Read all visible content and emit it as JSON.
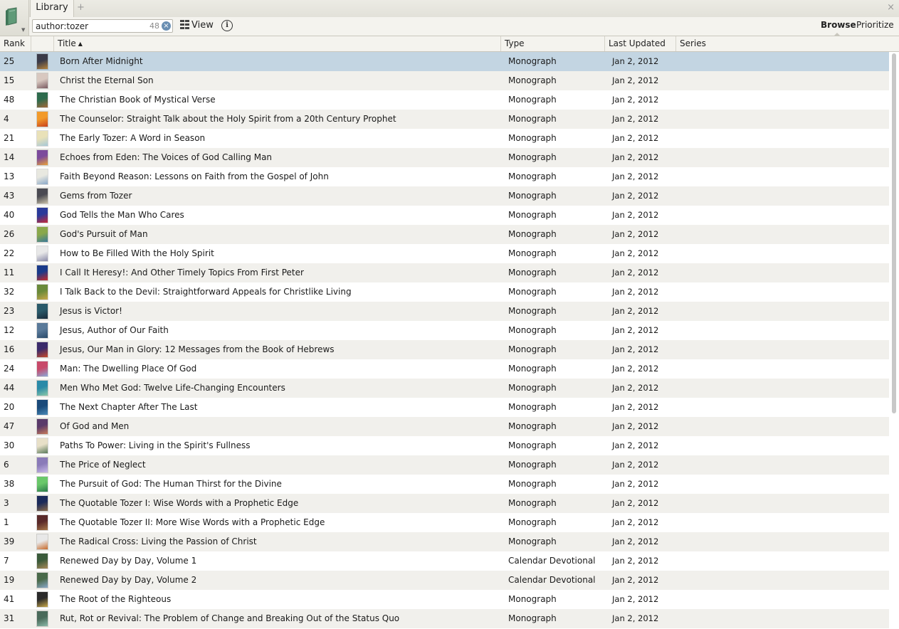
{
  "tabs": {
    "library": "Library",
    "add": "+",
    "close": "×"
  },
  "toolbar": {
    "search_value": "author:tozer",
    "result_count": "48",
    "clear_glyph": "×",
    "view_label": "View",
    "info_glyph": "i",
    "mode_browse": "Browse",
    "mode_prioritize": "Prioritize"
  },
  "columns": {
    "rank": "Rank",
    "title": "Title",
    "sort_arrow": "▲",
    "type": "Type",
    "updated": "Last Updated",
    "series": "Series"
  },
  "rows": [
    {
      "rank": "25",
      "title": "Born After Midnight",
      "type": "Monograph",
      "updated": "Jan 2, 2012",
      "cover": [
        "#3a3a48",
        "#b6843d"
      ]
    },
    {
      "rank": "15",
      "title": "Christ the Eternal Son",
      "type": "Monograph",
      "updated": "Jan 2, 2012",
      "cover": [
        "#d8c8c0",
        "#7a5a60"
      ]
    },
    {
      "rank": "48",
      "title": "The Christian Book of Mystical Verse",
      "type": "Monograph",
      "updated": "Jan 2, 2012",
      "cover": [
        "#2e6b4d",
        "#a36a3a"
      ]
    },
    {
      "rank": "4",
      "title": "The Counselor: Straight Talk about the Holy Spirit from a 20th Century Prophet",
      "type": "Monograph",
      "updated": "Jan 2, 2012",
      "cover": [
        "#f29a2a",
        "#c8401c"
      ]
    },
    {
      "rank": "21",
      "title": "The Early Tozer: A Word in Season",
      "type": "Monograph",
      "updated": "Jan 2, 2012",
      "cover": [
        "#e9e1b8",
        "#a6c8d8"
      ]
    },
    {
      "rank": "14",
      "title": "Echoes from Eden: The Voices of God Calling Man",
      "type": "Monograph",
      "updated": "Jan 2, 2012",
      "cover": [
        "#7c4a9c",
        "#e8a03a"
      ]
    },
    {
      "rank": "13",
      "title": "Faith Beyond Reason: Lessons on Faith from the Gospel of John",
      "type": "Monograph",
      "updated": "Jan 2, 2012",
      "cover": [
        "#e8e8e0",
        "#8aa8c8"
      ]
    },
    {
      "rank": "43",
      "title": "Gems from Tozer",
      "type": "Monograph",
      "updated": "Jan 2, 2012",
      "cover": [
        "#4a4a52",
        "#c8c0a8"
      ]
    },
    {
      "rank": "40",
      "title": "God Tells the Man Who Cares",
      "type": "Monograph",
      "updated": "Jan 2, 2012",
      "cover": [
        "#2a3a9a",
        "#c82a3a"
      ]
    },
    {
      "rank": "26",
      "title": "God's Pursuit of Man",
      "type": "Monograph",
      "updated": "Jan 2, 2012",
      "cover": [
        "#8aa84a",
        "#3a7a9a"
      ]
    },
    {
      "rank": "22",
      "title": "How to Be Filled With the Holy Spirit",
      "type": "Monograph",
      "updated": "Jan 2, 2012",
      "cover": [
        "#e8e8e8",
        "#8a8aa8"
      ]
    },
    {
      "rank": "11",
      "title": "I Call It Heresy!: And Other Timely Topics From First Peter",
      "type": "Monograph",
      "updated": "Jan 2, 2012",
      "cover": [
        "#1a3a8a",
        "#c82a2a"
      ]
    },
    {
      "rank": "32",
      "title": "I Talk Back to the Devil: Straightforward Appeals for Christlike Living",
      "type": "Monograph",
      "updated": "Jan 2, 2012",
      "cover": [
        "#6a8a3a",
        "#c8a84a"
      ]
    },
    {
      "rank": "23",
      "title": "Jesus is Victor!",
      "type": "Monograph",
      "updated": "Jan 2, 2012",
      "cover": [
        "#2a5a6a",
        "#1a2a3a"
      ]
    },
    {
      "rank": "12",
      "title": "Jesus, Author of Our Faith",
      "type": "Monograph",
      "updated": "Jan 2, 2012",
      "cover": [
        "#5a7a9a",
        "#2a4a6a"
      ]
    },
    {
      "rank": "16",
      "title": "Jesus, Our Man in Glory: 12 Messages from the Book of Hebrews",
      "type": "Monograph",
      "updated": "Jan 2, 2012",
      "cover": [
        "#3a2a6a",
        "#c84a2a"
      ]
    },
    {
      "rank": "24",
      "title": "Man: The Dwelling Place Of God",
      "type": "Monograph",
      "updated": "Jan 2, 2012",
      "cover": [
        "#c84a6a",
        "#8aa8d8"
      ]
    },
    {
      "rank": "44",
      "title": "Men Who Met God: Twelve Life-Changing Encounters",
      "type": "Monograph",
      "updated": "Jan 2, 2012",
      "cover": [
        "#2a8aa8",
        "#8ac8a8"
      ]
    },
    {
      "rank": "20",
      "title": "The Next Chapter After The Last",
      "type": "Monograph",
      "updated": "Jan 2, 2012",
      "cover": [
        "#1a4a7a",
        "#4a8ab8"
      ]
    },
    {
      "rank": "47",
      "title": "Of God and Men",
      "type": "Monograph",
      "updated": "Jan 2, 2012",
      "cover": [
        "#5a3a6a",
        "#c87a5a"
      ]
    },
    {
      "rank": "30",
      "title": "Paths To Power: Living in the Spirit's Fullness",
      "type": "Monograph",
      "updated": "Jan 2, 2012",
      "cover": [
        "#e8e0c8",
        "#5a7a5a"
      ]
    },
    {
      "rank": "6",
      "title": "The Price of Neglect",
      "type": "Monograph",
      "updated": "Jan 2, 2012",
      "cover": [
        "#8a7ab8",
        "#c8b8e8"
      ]
    },
    {
      "rank": "38",
      "title": "The Pursuit of God: The Human Thirst for the Divine",
      "type": "Monograph",
      "updated": "Jan 2, 2012",
      "cover": [
        "#6ac86a",
        "#2a7a4a"
      ]
    },
    {
      "rank": "3",
      "title": "The Quotable Tozer I: Wise Words with a Prophetic Edge",
      "type": "Monograph",
      "updated": "Jan 2, 2012",
      "cover": [
        "#1a2a5a",
        "#8a6a4a"
      ]
    },
    {
      "rank": "1",
      "title": "The Quotable Tozer II: More Wise Words with a Prophetic Edge",
      "type": "Monograph",
      "updated": "Jan 2, 2012",
      "cover": [
        "#5a2a2a",
        "#a8784a"
      ]
    },
    {
      "rank": "39",
      "title": "The Radical Cross: Living the Passion of Christ",
      "type": "Monograph",
      "updated": "Jan 2, 2012",
      "cover": [
        "#e8e8e8",
        "#c86a2a"
      ]
    },
    {
      "rank": "7",
      "title": "Renewed Day by Day, Volume 1",
      "type": "Calendar Devotional",
      "updated": "Jan 2, 2012",
      "cover": [
        "#3a5a3a",
        "#a88a5a"
      ]
    },
    {
      "rank": "19",
      "title": "Renewed Day by Day, Volume 2",
      "type": "Calendar Devotional",
      "updated": "Jan 2, 2012",
      "cover": [
        "#4a6a4a",
        "#8aa8c8"
      ]
    },
    {
      "rank": "41",
      "title": "The Root of the Righteous",
      "type": "Monograph",
      "updated": "Jan 2, 2012",
      "cover": [
        "#2a2a2a",
        "#c8a84a"
      ]
    },
    {
      "rank": "31",
      "title": "Rut, Rot or Revival: The Problem of Change and Breaking Out of the Status Quo",
      "type": "Monograph",
      "updated": "Jan 2, 2012",
      "cover": [
        "#4a6a5a",
        "#8ab8a8"
      ]
    }
  ],
  "colors": {
    "selected_row": "#c3d5e2",
    "alt_row": "#f1f0ec",
    "chrome": "#f4f3ee"
  },
  "icons": {
    "library": "library-book-icon",
    "view": "grid-icon",
    "info": "info-icon",
    "clear": "clear-icon"
  }
}
